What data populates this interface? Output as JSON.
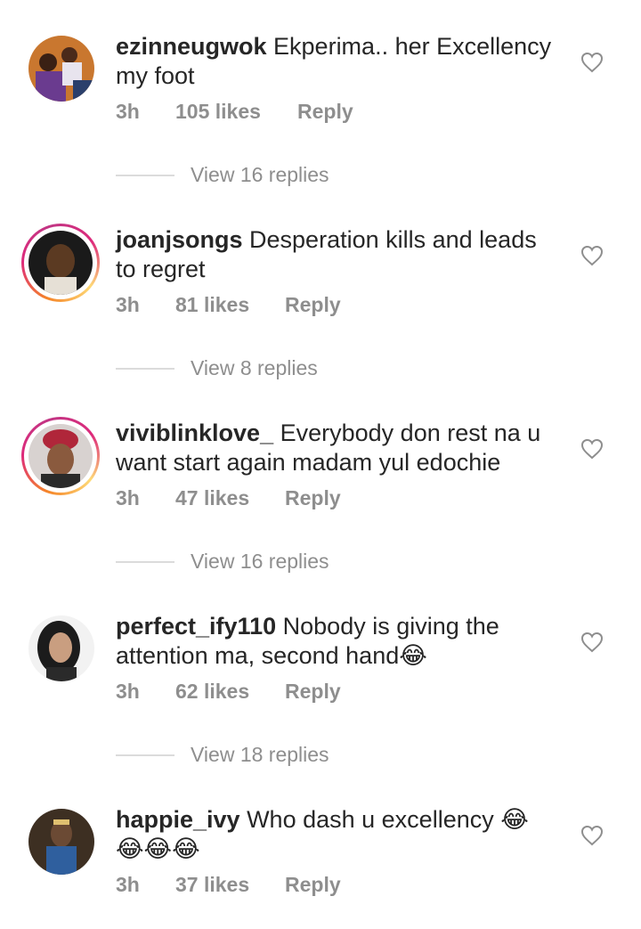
{
  "comments": [
    {
      "username": "ezinneugwok",
      "text": "Ekperima.. her Excellency my foot",
      "time": "3h",
      "likes": "105 likes",
      "reply_label": "Reply",
      "view_replies": "View 16 replies",
      "has_story_ring": false
    },
    {
      "username": "joanjsongs",
      "text": "Desperation kills and leads to regret",
      "time": "3h",
      "likes": "81 likes",
      "reply_label": "Reply",
      "view_replies": "View 8 replies",
      "has_story_ring": true
    },
    {
      "username": "viviblinklove_",
      "text": "Everybody don rest na u want start again madam yul edochie",
      "time": "3h",
      "likes": "47 likes",
      "reply_label": "Reply",
      "view_replies": "View 16 replies",
      "has_story_ring": true
    },
    {
      "username": "perfect_ify110",
      "text": "Nobody is giving the attention ma, second hand😂",
      "time": "3h",
      "likes": "62 likes",
      "reply_label": "Reply",
      "view_replies": "View 18 replies",
      "has_story_ring": false
    },
    {
      "username": "happie_ivy",
      "text": "Who dash u excellency 😂 😂😂😂",
      "time": "3h",
      "likes": "37 likes",
      "reply_label": "Reply",
      "has_story_ring": false
    }
  ],
  "icons": {
    "like": "heart-outline-icon"
  },
  "colors": {
    "text": "#262626",
    "secondary": "#8e8e8e",
    "divider": "#dbdbdb"
  }
}
